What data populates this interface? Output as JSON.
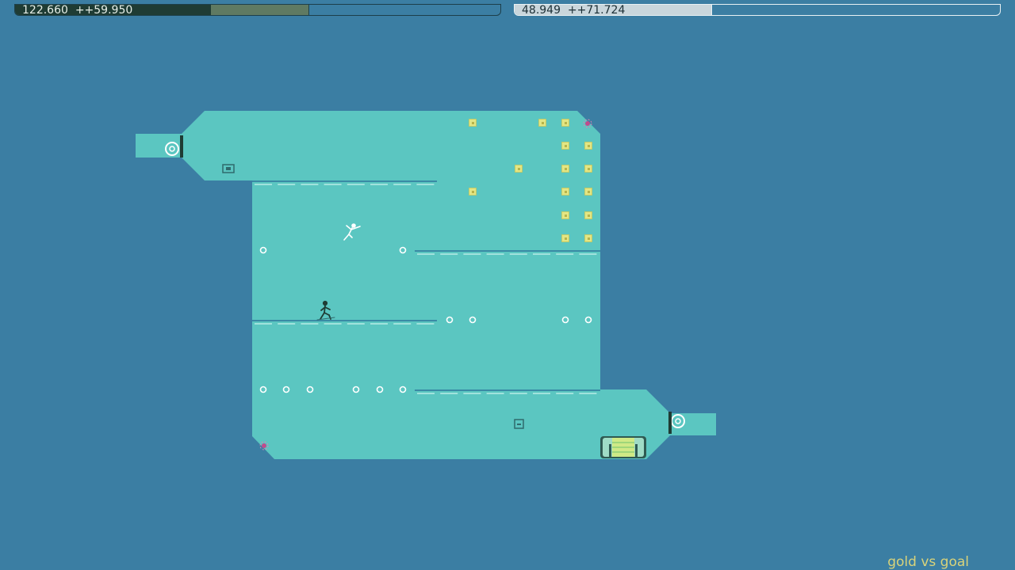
{
  "hud_left": {
    "time": "122.660",
    "bonus": "++59.950",
    "colors": {
      "elapsed": "#1f3c34",
      "gold_gain": "#5f7a62",
      "remaining": "#3b7ea3",
      "border": "#1d3f4a"
    },
    "fraction_elapsed": 0.405,
    "fraction_gold_gain": 0.2
  },
  "hud_right": {
    "time": "48.949",
    "bonus": "++71.724",
    "colors": {
      "filled": "#c9d6dc",
      "remaining": "#3b7ea3",
      "border": "#e8f1f4"
    },
    "fraction_filled": 0.406
  },
  "level_title": "gold vs goal",
  "colors": {
    "background": "#3b7ea3",
    "tile": "#5bc6c1",
    "gold": "#e3e684",
    "mine_ring": "#ffffff",
    "platform": "#3a8aa5",
    "exit_door": "#cfe986",
    "ninja": "#1f3c34",
    "ghost_ninja": "#ffffff",
    "drone": "#c04b8c"
  },
  "icons": {
    "ninja": "ninja-player-icon",
    "ghost": "ghost-replay-icon",
    "gold": "gold-square-icon",
    "mine": "toggle-mine-icon",
    "door": "exit-door-icon",
    "switch": "switch-icon",
    "launchpad": "launchpad-icon"
  }
}
